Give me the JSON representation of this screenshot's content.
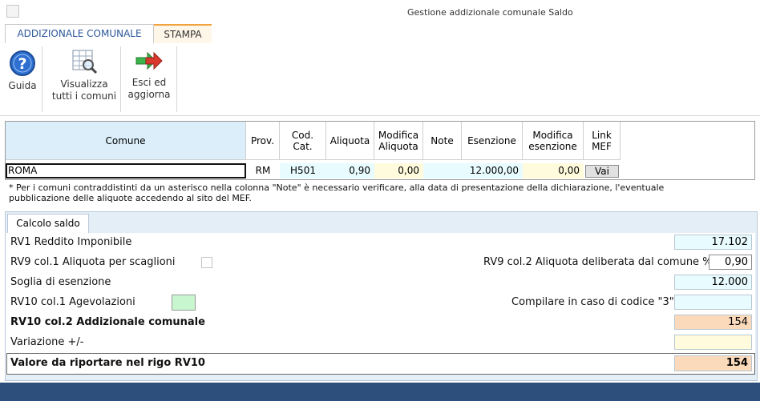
{
  "window": {
    "title": "Gestione addizionale comunale Saldo"
  },
  "ribbon": {
    "tabs": [
      "ADDIZIONALE COMUNALE",
      "STAMPA"
    ],
    "buttons": {
      "guida": "Guida",
      "visualizza_1": "Visualizza",
      "visualizza_2": "tutti i comuni",
      "esci_1": "Esci ed",
      "esci_2": "aggiorna"
    }
  },
  "grid": {
    "headers": {
      "comune": "Comune",
      "prov": "Prov.",
      "codcat_1": "Cod.",
      "codcat_2": "Cat.",
      "aliquota": "Aliquota",
      "modali_1": "Modifica",
      "modali_2": "Aliquota",
      "note": "Note",
      "esenzione": "Esenzione",
      "modes_1": "Modifica",
      "modes_2": "esenzione",
      "link_1": "Link",
      "link_2": "MEF"
    },
    "row": {
      "comune": "ROMA",
      "prov": "RM",
      "codcat": "H501",
      "aliquota": "0,90",
      "modifica_aliquota": "0,00",
      "note": "",
      "esenzione": "12.000,00",
      "modifica_esenzione": "0,00",
      "link": "Vai"
    }
  },
  "note_text": {
    "line1": "* Per i comuni contraddistinti da un asterisco nella colonna \"Note\" è necessario verificare,  alla data di presentazione della dichiarazione, l'eventuale",
    "line2": "pubblicazione delle aliquote accedendo al sito del MEF."
  },
  "calcolo": {
    "tab": "Calcolo saldo",
    "rv1_label": "RV1 Reddito Imponibile",
    "rv1_value": "17.102",
    "rv9_col1_label": "RV9 col.1 Aliquota per scaglioni",
    "rv9_col2_label": "RV9 col.2 Aliquota deliberata dal comune %",
    "rv9_col2_value": "0,90",
    "soglia_label": "Soglia di esenzione",
    "soglia_value": "12.000",
    "rv10_col1_label": "RV10 col.1 Agevolazioni",
    "codice3_label": "Compilare in caso di codice \"3\"",
    "codice3_value": "",
    "rv10_col2_label": "RV10 col.2 Addizionale comunale",
    "rv10_col2_value": "154",
    "variazione_label": "Variazione +/-",
    "variazione_value": "",
    "valore_label": "Valore da riportare nel rigo RV10",
    "valore_value": "154"
  }
}
